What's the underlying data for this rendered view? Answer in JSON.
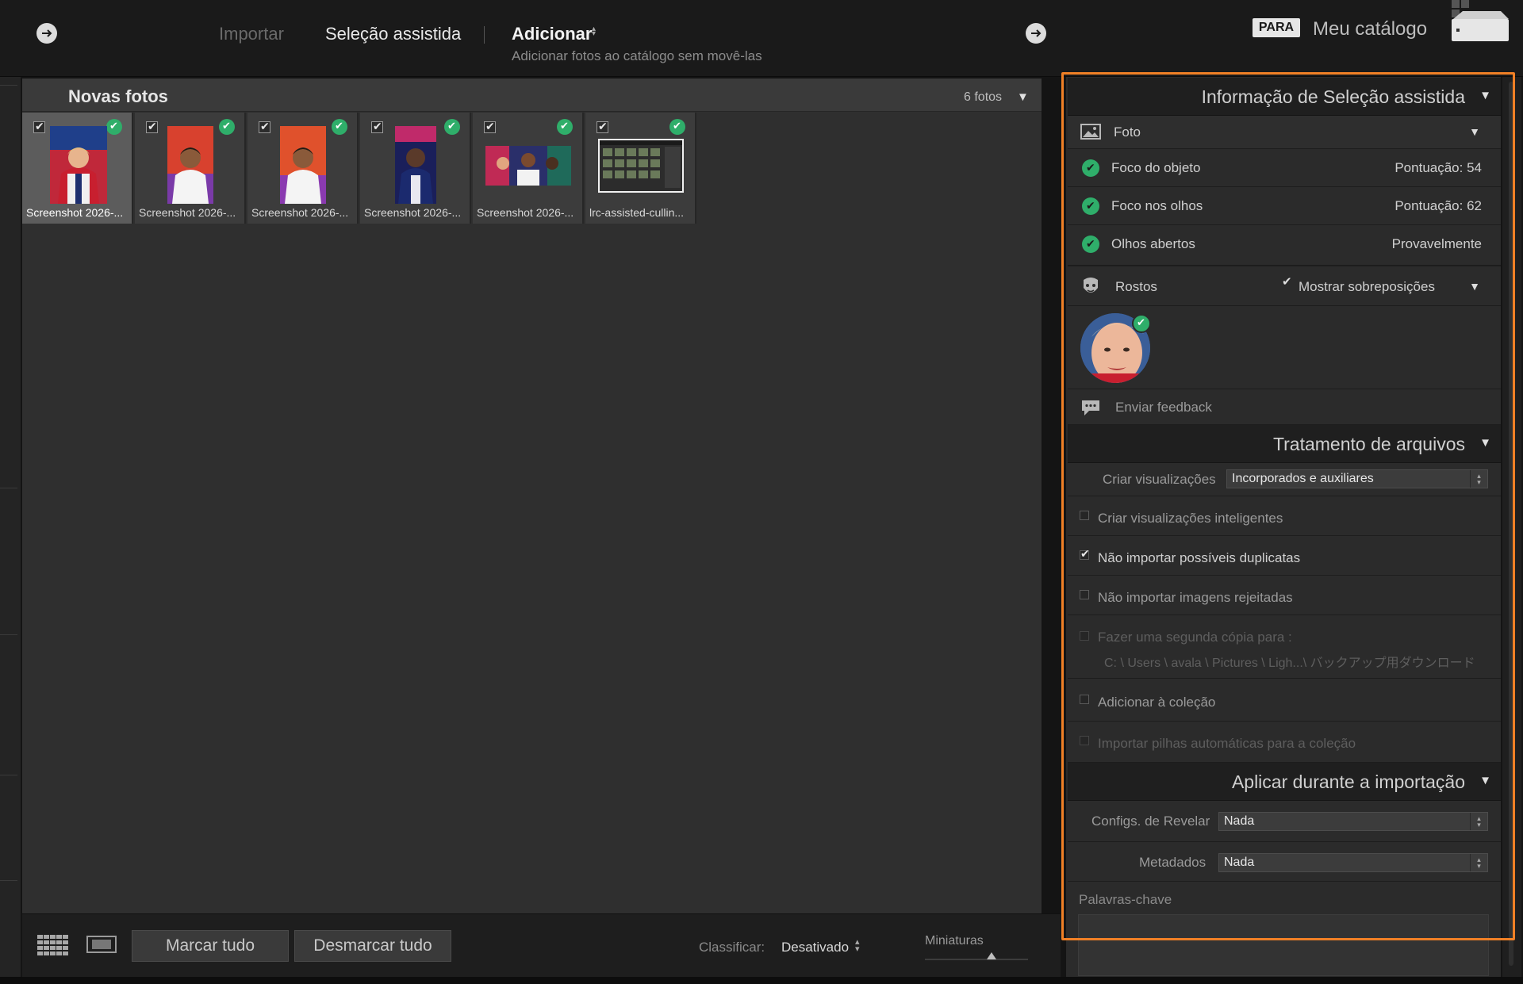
{
  "topbar": {
    "mode_import": "Importar",
    "mode_culling": "Seleção assistida",
    "mode_add": "Adicionar",
    "mode_add_subtitle": "Adicionar fotos ao catálogo sem movê-las",
    "to_badge": "PARA",
    "catalog_name": "Meu catálogo"
  },
  "grid": {
    "title": "Novas fotos",
    "count": "6 fotos",
    "thumbnails": [
      {
        "name": "Screenshot 2026-...",
        "selected": true
      },
      {
        "name": "Screenshot 2026-..."
      },
      {
        "name": "Screenshot 2026-..."
      },
      {
        "name": "Screenshot 2026-..."
      },
      {
        "name": "Screenshot 2026-..."
      },
      {
        "name": "lrc-assisted-cullin..."
      }
    ]
  },
  "footer": {
    "check_all": "Marcar tudo",
    "uncheck_all": "Desmarcar tudo",
    "sort_label": "Classificar:",
    "sort_value": "Desativado",
    "thumb_size_label": "Miniaturas"
  },
  "culling_info": {
    "title": "Informação de Seleção assistida",
    "photo_label": "Foto",
    "subject_focus": {
      "label": "Foco do objeto",
      "value": "Pontuação: 54"
    },
    "eye_focus": {
      "label": "Foco nos olhos",
      "value": "Pontuação: 62"
    },
    "eyes_open": {
      "label": "Olhos abertos",
      "value": "Provavelmente"
    },
    "faces_label": "Rostos",
    "show_overlays": "Mostrar sobreposições",
    "feedback": "Enviar feedback"
  },
  "file_handling": {
    "title": "Tratamento de arquivos",
    "build_previews_label": "Criar visualizações",
    "build_previews_value": "Incorporados e auxiliares",
    "smart_previews": "Criar visualizações inteligentes",
    "no_duplicates": "Não importar possíveis duplicatas",
    "no_rejected": "Não importar imagens rejeitadas",
    "second_copy": "Fazer uma segunda cópia para :",
    "second_copy_path": "C: \\ Users \\ avala \\ Pictures \\ Ligh...\\ バックアップ用ダウンロード",
    "add_to_collection": "Adicionar à coleção",
    "auto_stacks": "Importar pilhas automáticas para a coleção"
  },
  "apply_during_import": {
    "title": "Aplicar durante a importação",
    "develop_label": "Configs. de Revelar",
    "develop_value": "Nada",
    "metadata_label": "Metadados",
    "metadata_value": "Nada",
    "keywords_label": "Palavras-chave"
  },
  "colors": {
    "accent_green": "#2fae6a",
    "highlight_orange": "#f08026"
  }
}
